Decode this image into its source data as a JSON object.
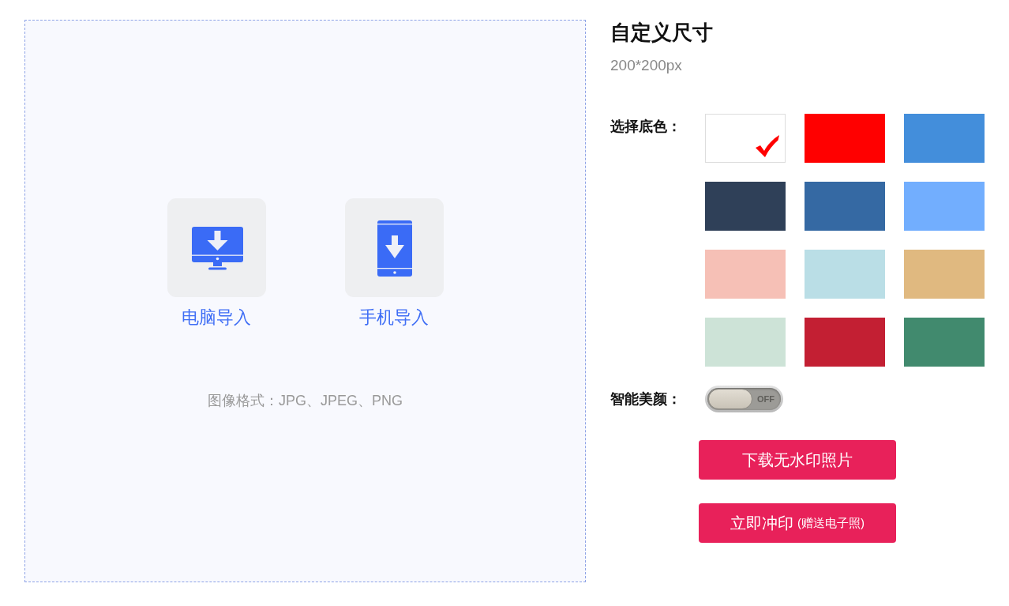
{
  "import_panel": {
    "options": [
      {
        "kind": "computer",
        "label": "电脑导入"
      },
      {
        "kind": "phone",
        "label": "手机导入"
      }
    ],
    "format_note": "图像格式：JPG、JPEG、PNG"
  },
  "size": {
    "title": "自定义尺寸",
    "dimensions": "200*200px"
  },
  "background": {
    "label": "选择底色：",
    "colors": [
      {
        "color": "#ffffff",
        "selected": true
      },
      {
        "color": "#ff0000",
        "selected": false
      },
      {
        "color": "#438edb",
        "selected": false
      },
      {
        "color": "#2f4058",
        "selected": false
      },
      {
        "color": "#3569a3",
        "selected": false
      },
      {
        "color": "#72aefe",
        "selected": false
      },
      {
        "color": "#f6c0b6",
        "selected": false
      },
      {
        "color": "#badee6",
        "selected": false
      },
      {
        "color": "#e0b980",
        "selected": false
      },
      {
        "color": "#cde3d7",
        "selected": false
      },
      {
        "color": "#c31f33",
        "selected": false
      },
      {
        "color": "#418a6e",
        "selected": false
      }
    ]
  },
  "beauty": {
    "label": "智能美颜：",
    "on": false,
    "state_label": "OFF"
  },
  "buttons": [
    {
      "label": "下载无水印照片"
    },
    {
      "label": "立即冲印",
      "note": "(赠送电子照)"
    }
  ]
}
